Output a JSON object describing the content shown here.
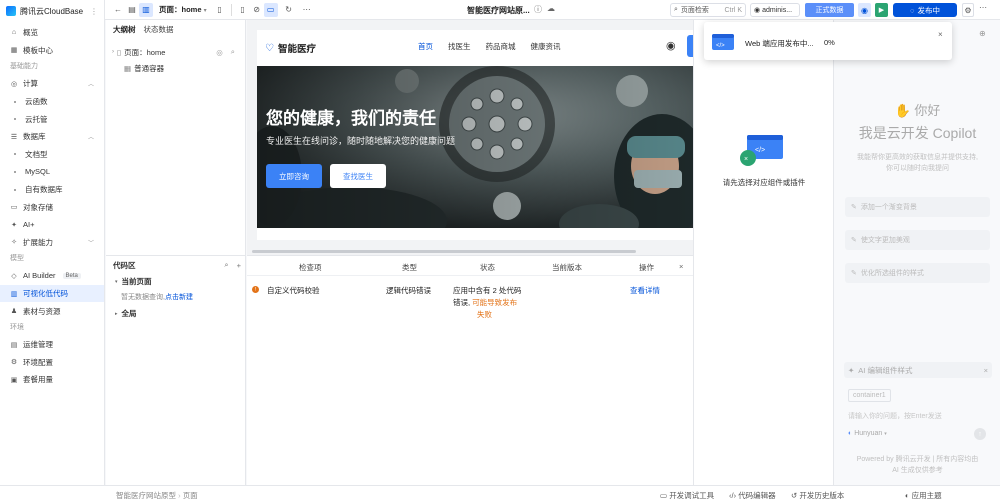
{
  "brand": {
    "name": "腾讯云CloudBase"
  },
  "nav": {
    "items": [
      {
        "label": "概览",
        "icon": "home-icon"
      },
      {
        "label": "模板中心",
        "icon": "template-icon"
      }
    ],
    "group_basic": "基础能力",
    "compute": {
      "label": "计算",
      "subs": [
        "云函数",
        "云托管"
      ]
    },
    "database": {
      "label": "数据库",
      "subs": [
        "文档型",
        "MySQL",
        "自有数据库"
      ]
    },
    "storage": "对象存储",
    "ai": "AI+",
    "extend": "扩展能力",
    "group_model": "模型",
    "ai_builder": "AI Builder",
    "beta": "Beta",
    "visual": "可视化低代码",
    "assets": "素材与资源",
    "group_env": "环境",
    "ops": "运维管理",
    "envcfg": "环境配置",
    "billing": "套餐用量"
  },
  "toolbar": {
    "page_label": "页面：home",
    "title": "智能医疗网站原...",
    "search_label": "页面检索",
    "search_shortcut": "Ctrl K",
    "user": "adminis...",
    "env": "正式数据",
    "publish": "发布中"
  },
  "panel": {
    "tab_outline": "大纲树",
    "tab_state": "状态数据",
    "tree_page": "页面：home",
    "tree_container": "普通容器",
    "code_title": "代码区",
    "current_page": "当前页面",
    "empty_text": "暂无数据查询,",
    "create_link": "点击新建",
    "global": "全局"
  },
  "site": {
    "logo": "智能医疗",
    "menu": [
      "首页",
      "找医生",
      "药品商城",
      "健康资讯"
    ],
    "hero_title": "您的健康，我们的责任",
    "hero_subtitle": "专业医生在线问诊，随时随地解决您的健康问题",
    "btn_primary": "立即咨询",
    "btn_secondary": "查找医生"
  },
  "check": {
    "headers": [
      "检查项",
      "类型",
      "状态",
      "当前版本",
      "操作"
    ],
    "row": {
      "item": "自定义代码校验",
      "type": "逻辑代码错误",
      "status_line1": "应用中含有 2 处代码",
      "status_line2": "错误,",
      "status_warn1": "可能导致发布",
      "status_warn2": "失败",
      "version": "",
      "action": "查看详情"
    }
  },
  "right": {
    "empty": "请先选择对应组件或插件"
  },
  "copilot": {
    "hello": "你好",
    "title": "我是云开发 Copilot",
    "desc1": "我能帮你更高效的获取信息并提供支持,",
    "desc2": "你可以随时向我提问",
    "sugg": [
      "添加一个渐变背景",
      "使文字更加美观",
      "优化所选组件的样式"
    ],
    "ai_style": "AI 编辑组件样式",
    "chip": "container1",
    "placeholder": "请输入你的问题，按Enter发送",
    "model": "Hunyuan",
    "footer1": "Powered by 腾讯云开发 | 所有内容均由",
    "footer2": "AI 生成仅供参考"
  },
  "toast": {
    "text": "Web 端应用发布中...",
    "percent": "0%"
  },
  "status": {
    "crumb1": "智能医疗网站原型",
    "crumb2": "页面",
    "debug": "开发调试工具",
    "code_editor": "代码编辑器",
    "history": "开发历史版本",
    "theme": "应用主题"
  }
}
